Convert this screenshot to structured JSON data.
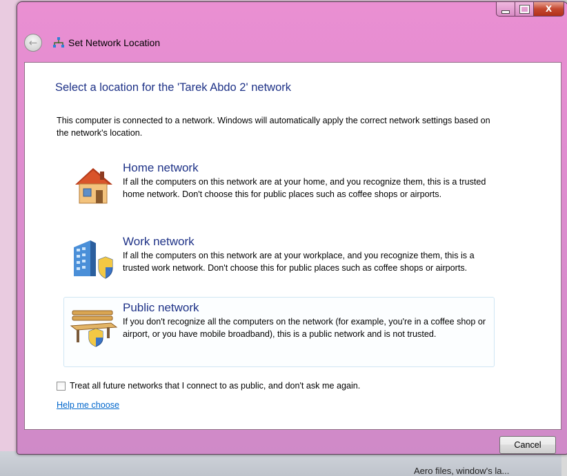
{
  "window": {
    "title": "Set Network Location",
    "back_icon": "back-arrow-icon",
    "network_icon": "network-icon"
  },
  "content": {
    "heading": "Select a location for the 'Tarek Abdo  2' network",
    "intro": "This computer is connected to a network. Windows will automatically apply the correct network settings based on the network's location.",
    "options": [
      {
        "icon": "home-network-icon",
        "title": "Home network",
        "description": "If all the computers on this network are at your home, and you recognize them, this is a trusted home network.  Don't choose this for public places such as coffee shops or airports."
      },
      {
        "icon": "work-network-icon",
        "title": "Work network",
        "description": "If all the computers on this network are at your workplace, and you recognize them, this is a trusted work network.  Don't choose this for public places such as coffee shops or airports."
      },
      {
        "icon": "public-network-icon",
        "title": "Public network",
        "description": "If you don't recognize all the computers on the network (for example, you're in a coffee shop or airport, or you have mobile broadband), this is a public network and is not trusted."
      }
    ],
    "checkbox_label": "Treat all future networks that I connect to as public, and don't ask me again.",
    "checkbox_checked": false,
    "help_link": "Help me choose"
  },
  "buttons": {
    "cancel": "Cancel",
    "minimize_icon": "minimize-icon",
    "maximize_icon": "maximize-icon",
    "close_icon": "close-icon",
    "close_glyph": "X"
  },
  "desktop": {
    "partial_text": "Aero files, window's la..."
  },
  "colors": {
    "frame": "#e08bd0",
    "heading": "#1e3287",
    "link": "#0066cc",
    "close_button": "#c4482f"
  }
}
